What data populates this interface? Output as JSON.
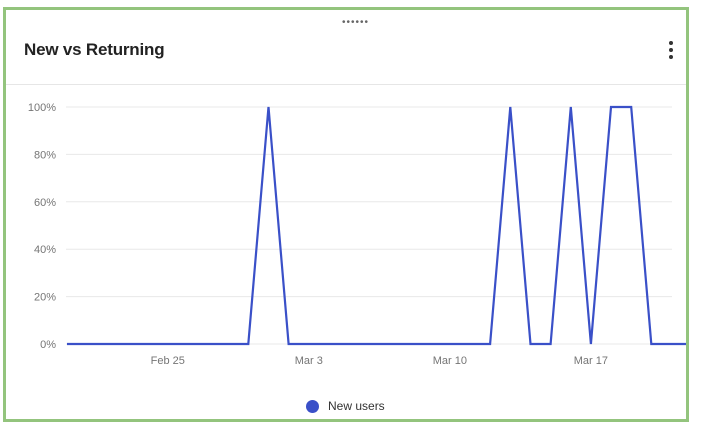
{
  "card": {
    "title": "New vs Returning",
    "drag_handle": "••••••",
    "menu_icon": "more-vert-icon"
  },
  "colors": {
    "series": "#3a50c8",
    "frame": "#93c47d",
    "grid": "#e8e8e8",
    "axis_text": "#757575"
  },
  "chart_data": {
    "type": "line",
    "title": "",
    "xlabel": "",
    "ylabel": "",
    "y_ticks": [
      "0%",
      "20%",
      "40%",
      "60%",
      "80%",
      "100%"
    ],
    "y_tick_values": [
      0,
      20,
      40,
      60,
      80,
      100
    ],
    "ylim": [
      0,
      100
    ],
    "x_ticks": [
      "Feb 25",
      "Mar 3",
      "Mar 10",
      "Mar 17"
    ],
    "x_tick_days": [
      5,
      12,
      19,
      26
    ],
    "x": [
      "Feb 20",
      "Feb 21",
      "Feb 22",
      "Feb 23",
      "Feb 24",
      "Feb 25",
      "Feb 26",
      "Feb 27",
      "Feb 28",
      "Mar 1",
      "Mar 2",
      "Mar 3",
      "Mar 4",
      "Mar 5",
      "Mar 6",
      "Mar 7",
      "Mar 8",
      "Mar 9",
      "Mar 10",
      "Mar 11",
      "Mar 12",
      "Mar 13",
      "Mar 14",
      "Mar 15",
      "Mar 16",
      "Mar 17",
      "Mar 18",
      "Mar 19",
      "Mar 20",
      "Mar 21",
      "Mar 22",
      "Mar 23"
    ],
    "series": [
      {
        "name": "New users",
        "values": [
          0,
          0,
          0,
          0,
          0,
          0,
          0,
          0,
          0,
          0,
          100,
          0,
          0,
          0,
          0,
          0,
          0,
          0,
          0,
          0,
          0,
          0,
          100,
          0,
          0,
          100,
          0,
          100,
          100,
          0,
          0,
          0
        ]
      }
    ],
    "grid": true,
    "legend": "bottom-center"
  }
}
